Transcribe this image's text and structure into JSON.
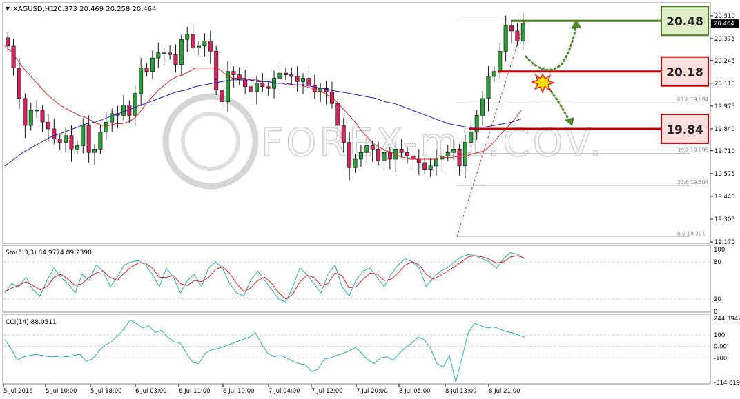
{
  "header": {
    "symbol": "XAGUSD,H1",
    "ohlc": "20.373 20.469 20.258 20.464"
  },
  "watermark": "FOREX-m1.COV.",
  "levels": [
    {
      "label": "20.48",
      "kind": "resistance",
      "color": "#4a7a22",
      "fill": "#dff0c8"
    },
    {
      "label": "20.18",
      "kind": "support",
      "color": "#c00000",
      "fill": "#ffdede"
    },
    {
      "label": "19.84",
      "kind": "support",
      "color": "#c00000",
      "fill": "#ffdede"
    }
  ],
  "colors": {
    "bull": "#2e9d3a",
    "bear": "#d0265e",
    "ma_fast": "#e02020",
    "ma_slow": "#2020c0",
    "stoch_main": "#20b0b0",
    "stoch_signal": "#e02020",
    "cci": "#20b0b0"
  },
  "chart_data": [
    {
      "type": "candlestick",
      "title": "XAGUSD,H1",
      "ylim": [
        19.17,
        20.53
      ],
      "y_ticks": [
        "20.510",
        "20.375",
        "20.245",
        "20.110",
        "19.975",
        "19.840",
        "19.710",
        "19.575",
        "19.440",
        "19.305",
        "19.170"
      ],
      "current_price": "20.464",
      "x_labels": [
        "5 Jul 2016",
        "5 Jul 10:00",
        "5 Jul 18:00",
        "6 Jul 03:00",
        "6 Jul 11:00",
        "6 Jul 19:00",
        "7 Jul 04:00",
        "7 Jul 12:00",
        "7 Jul 20:00",
        "8 Jul 05:00",
        "8 Jul 13:00",
        "8 Jul 21:00"
      ],
      "fib_levels": [
        {
          "label": "61.8 19.994",
          "value": 19.994
        },
        {
          "label": "38.2 19.695",
          "value": 19.695
        },
        {
          "label": "23.6 19.504",
          "value": 19.504
        },
        {
          "label": "0.0 19.201",
          "value": 19.201
        }
      ],
      "close": [
        20.33,
        20.2,
        20.02,
        19.86,
        19.95,
        19.95,
        19.88,
        19.84,
        19.78,
        19.76,
        19.8,
        19.72,
        19.74,
        19.86,
        19.7,
        19.72,
        19.82,
        19.88,
        19.93,
        19.92,
        19.98,
        19.92,
        20.05,
        20.2,
        20.18,
        20.26,
        20.29,
        20.29,
        20.28,
        20.22,
        20.37,
        20.4,
        20.32,
        20.33,
        20.36,
        20.3,
        20.07,
        20.0,
        20.18,
        20.16,
        20.13,
        20.09,
        20.06,
        20.11,
        20.09,
        20.08,
        20.14,
        20.17,
        20.16,
        20.15,
        20.12,
        20.14,
        20.1,
        20.06,
        20.08,
        20.06,
        19.99,
        19.86,
        19.76,
        19.61,
        19.66,
        19.7,
        19.74,
        19.72,
        19.65,
        19.7,
        19.66,
        19.72,
        19.7,
        19.68,
        19.66,
        19.64,
        19.6,
        19.62,
        19.66,
        19.68,
        19.7,
        19.72,
        19.62,
        19.76,
        19.82,
        19.92,
        20.02,
        20.15,
        20.18,
        20.3,
        20.45,
        20.42,
        20.36,
        20.464
      ],
      "ma_fast": [
        20.33,
        20.3,
        20.25,
        20.2,
        20.16,
        20.12,
        20.08,
        20.04,
        20.01,
        19.98,
        19.96,
        19.94,
        19.92,
        19.91,
        19.89,
        19.87,
        19.86,
        19.86,
        19.87,
        19.87,
        19.88,
        19.9,
        19.94,
        19.99,
        20.03,
        20.07,
        20.1,
        20.13,
        20.15,
        20.16,
        20.18,
        20.2,
        20.2,
        20.2,
        20.2,
        20.19,
        20.16,
        20.14,
        20.14,
        20.14,
        20.13,
        20.13,
        20.12,
        20.12,
        20.11,
        20.11,
        20.1,
        20.1,
        20.1,
        20.09,
        20.08,
        20.07,
        20.05,
        20.03,
        20.0,
        19.96,
        19.92,
        19.88,
        19.83,
        19.79,
        19.75,
        19.73,
        19.71,
        19.7,
        19.68,
        19.67,
        19.66,
        19.66,
        19.66,
        19.66,
        19.66,
        19.67,
        19.67,
        19.67,
        19.68,
        19.68,
        19.69,
        19.7,
        19.71,
        19.74,
        19.78,
        19.82,
        19.86,
        19.9,
        19.95
      ],
      "ma_slow": [
        19.62,
        19.66,
        19.7,
        19.73,
        19.76,
        19.79,
        19.81,
        19.83,
        19.85,
        19.87,
        19.88,
        19.9,
        19.92,
        19.94,
        19.96,
        19.98,
        20.0,
        20.02,
        20.04,
        20.06,
        20.07,
        20.09,
        20.1,
        20.11,
        20.12,
        20.13,
        20.13,
        20.13,
        20.12,
        20.12,
        20.11,
        20.11,
        20.1,
        20.1,
        20.09,
        20.08,
        20.07,
        20.06,
        20.05,
        20.04,
        20.03,
        20.02,
        20.0,
        19.99,
        19.97,
        19.95,
        19.93,
        19.91,
        19.89,
        19.87,
        19.86,
        19.85,
        19.85,
        19.85,
        19.86,
        19.87,
        19.88,
        19.9
      ]
    },
    {
      "type": "line",
      "title": "Sto(5,3,3) 84.9774 89.2398",
      "ylim": [
        0,
        100
      ],
      "y_ticks": [
        "100",
        "80",
        "20",
        "0"
      ],
      "series": [
        {
          "name": "main",
          "values": [
            30,
            45,
            40,
            55,
            35,
            25,
            50,
            70,
            55,
            45,
            30,
            60,
            50,
            75,
            65,
            40,
            55,
            75,
            80,
            82,
            75,
            60,
            40,
            70,
            55,
            30,
            50,
            60,
            40,
            70,
            80,
            70,
            45,
            30,
            25,
            50,
            65,
            50,
            35,
            20,
            15,
            40,
            70,
            60,
            45,
            30,
            60,
            75,
            40,
            25,
            50,
            65,
            70,
            55,
            40,
            60,
            75,
            85,
            80,
            70,
            40,
            55,
            65,
            70,
            80,
            88,
            92,
            90,
            85,
            80,
            70,
            85,
            95,
            92,
            85
          ]
        },
        {
          "name": "signal",
          "values": [
            32,
            38,
            42,
            48,
            42,
            35,
            40,
            55,
            60,
            52,
            42,
            45,
            55,
            62,
            65,
            55,
            50,
            62,
            72,
            78,
            78,
            70,
            55,
            55,
            58,
            45,
            42,
            50,
            48,
            55,
            68,
            72,
            62,
            45,
            32,
            38,
            50,
            55,
            45,
            30,
            20,
            28,
            48,
            58,
            55,
            42,
            45,
            62,
            58,
            38,
            40,
            52,
            62,
            60,
            50,
            52,
            62,
            75,
            80,
            75,
            60,
            52,
            58,
            65,
            72,
            80,
            88,
            90,
            88,
            84,
            78,
            80,
            88,
            90,
            86
          ]
        }
      ]
    },
    {
      "type": "line",
      "title": "CCI(14) 88.0511",
      "y_ticks": [
        "244.3942",
        "100",
        "0.00",
        "-100",
        "-314.8191"
      ],
      "ylim": [
        -314.8191,
        244.3942
      ],
      "series": [
        {
          "name": "CCI",
          "values": [
            60,
            -20,
            -120,
            -90,
            -80,
            -70,
            -80,
            -90,
            -90,
            -85,
            -90,
            -80,
            -70,
            -130,
            -110,
            -40,
            10,
            40,
            90,
            150,
            230,
            200,
            160,
            180,
            120,
            140,
            80,
            40,
            30,
            -60,
            -140,
            -150,
            -60,
            -30,
            -20,
            0,
            20,
            40,
            60,
            80,
            120,
            20,
            -60,
            -90,
            -80,
            -100,
            -130,
            -150,
            -160,
            -220,
            -200,
            -110,
            -100,
            -80,
            -60,
            -40,
            -10,
            -60,
            -120,
            -150,
            -100,
            -90,
            -120,
            -60,
            -10,
            30,
            80,
            60,
            -20,
            -150,
            -180,
            -80,
            -310,
            -100,
            120,
            200,
            180,
            160,
            170,
            150,
            130,
            120,
            100,
            80
          ]
        }
      ]
    }
  ]
}
